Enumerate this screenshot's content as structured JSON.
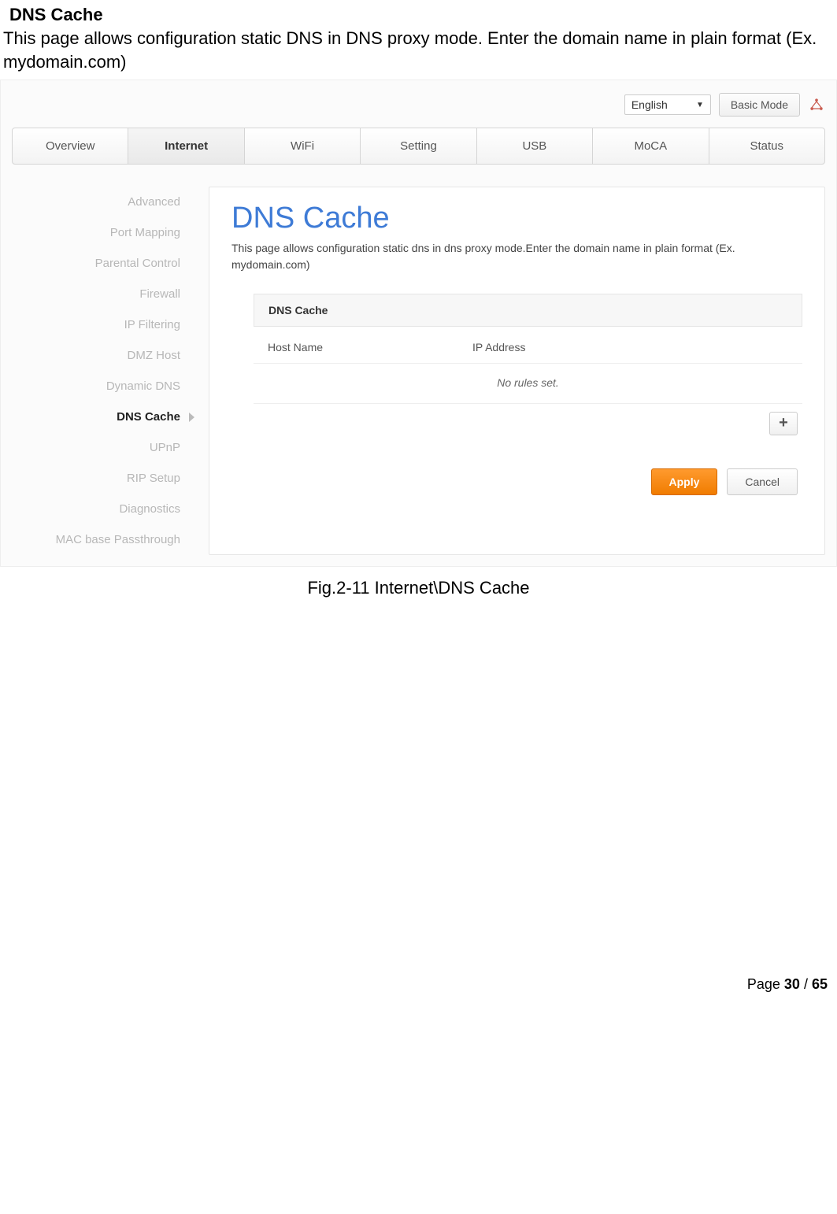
{
  "doc": {
    "heading": "DNS Cache",
    "intro": "This page allows configuration static DNS in DNS proxy mode. Enter the domain name in plain format (Ex. mydomain.com)",
    "caption": "Fig.2-11 Internet\\DNS Cache",
    "page_label_prefix": "Page ",
    "page_current": "30",
    "page_sep": " / ",
    "page_total": "65"
  },
  "ui": {
    "language": "English",
    "mode_button": "Basic Mode",
    "nav": [
      "Overview",
      "Internet",
      "WiFi",
      "Setting",
      "USB",
      "MoCA",
      "Status"
    ],
    "nav_active_index": 1,
    "sidebar": [
      "Advanced",
      "Port Mapping",
      "Parental Control",
      "Firewall",
      "IP Filtering",
      "DMZ Host",
      "Dynamic DNS",
      "DNS Cache",
      "UPnP",
      "RIP Setup",
      "Diagnostics",
      "MAC base Passthrough"
    ],
    "sidebar_active_index": 7,
    "page_title": "DNS Cache",
    "page_desc": "This page allows configuration static dns in dns proxy mode.Enter the domain name in plain format (Ex. mydomain.com)",
    "section_label": "DNS Cache",
    "col_host": "Host Name",
    "col_ip": "IP Address",
    "empty_text": "No rules set.",
    "add_label": "+",
    "apply_label": "Apply",
    "cancel_label": "Cancel"
  }
}
